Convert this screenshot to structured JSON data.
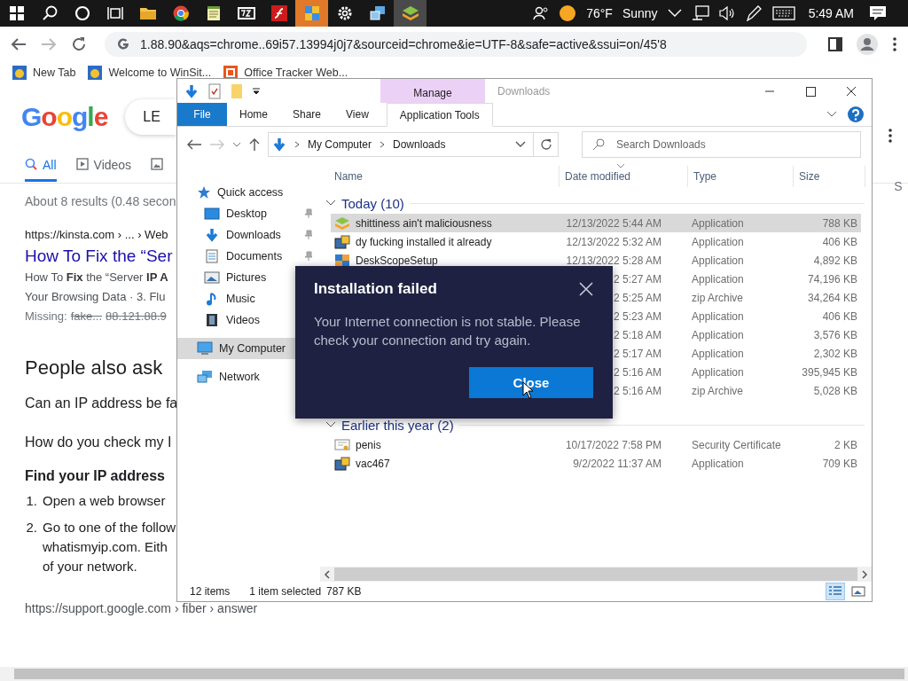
{
  "taskbar": {
    "apps": [
      {
        "kind": "windows",
        "selected": false
      },
      {
        "kind": "search",
        "selected": false
      },
      {
        "kind": "cortana",
        "selected": false
      },
      {
        "kind": "taskview",
        "selected": false
      },
      {
        "kind": "folder",
        "selected": false
      },
      {
        "kind": "chrome",
        "selected": false
      },
      {
        "kind": "notepad",
        "selected": false
      },
      {
        "kind": "sevenzip",
        "selected": false
      },
      {
        "kind": "flash",
        "selected": false
      },
      {
        "kind": "tiles",
        "selected": true
      },
      {
        "kind": "gear",
        "selected": false
      },
      {
        "kind": "network-app",
        "selected": false
      },
      {
        "kind": "stack",
        "selected": true
      }
    ],
    "tray": {
      "temperature": "76°F",
      "weather": "Sunny",
      "time": "5:49 AM"
    }
  },
  "browser": {
    "url": "1.88.90&aqs=chrome..69i57.13994j0j7&sourceid=chrome&ie=UTF-8&safe=active&ssui=on/45'8",
    "bookmarks": [
      {
        "label": "New Tab",
        "kind": "globe"
      },
      {
        "label": "Welcome to WinSit...",
        "kind": "globe"
      },
      {
        "label": "Office Tracker Web...",
        "kind": "office"
      }
    ]
  },
  "google": {
    "logo": "Google",
    "query": "LE",
    "edge_tab": "S",
    "tabs": [
      {
        "label": "All",
        "kind": "search",
        "selected": true
      },
      {
        "label": "Videos",
        "kind": "video",
        "selected": false
      },
      {
        "kind": "image",
        "selected": false
      }
    ],
    "stats": "About 8 results (0.48 secon",
    "result": {
      "url": "https://kinsta.com › ... › Web",
      "title": "How To Fix the “Ser",
      "snippet": [
        "How To **Fix** the “Server **IP A**",
        "Your Browsing Data · 3. Flu"
      ],
      "missing_label": "Missing:",
      "missing_terms": [
        "fake...",
        "88.121.88.9"
      ]
    },
    "people_also_ask": {
      "title": "People also ask",
      "questions": [
        "Can an IP address be fa",
        "How do you check my I"
      ]
    },
    "answer": {
      "heading": "Find your IP address",
      "steps": [
        {
          "number": "1.",
          "lines": [
            "Open a web browser"
          ]
        },
        {
          "number": "2.",
          "lines": [
            "Go to one of the follow",
            "whatismyip.com. Eith",
            "of your network."
          ]
        }
      ]
    },
    "source": "https://support.google.com › fiber › answer"
  },
  "explorer": {
    "title": "Downloads",
    "context_tab": "Manage",
    "ribbon_tabs": [
      {
        "label": "File",
        "kind": "file",
        "selected": false
      },
      {
        "label": "Home",
        "kind": "tab",
        "selected": false
      },
      {
        "label": "Share",
        "kind": "tab",
        "selected": false
      },
      {
        "label": "View",
        "kind": "tab",
        "selected": false
      },
      {
        "label": "Application Tools",
        "kind": "tab",
        "selected": true
      }
    ],
    "path": [
      "My Computer",
      "Downloads"
    ],
    "search_placeholder": "Search Downloads",
    "nav": [
      {
        "label": "Quick access",
        "kind": "star",
        "pinned": false,
        "selected": false,
        "children": [
          {
            "label": "Desktop",
            "kind": "desktop",
            "pinned": true,
            "selected": false
          },
          {
            "label": "Downloads",
            "kind": "download",
            "pinned": true,
            "selected": false
          },
          {
            "label": "Documents",
            "kind": "document",
            "pinned": true,
            "selected": false
          },
          {
            "label": "Pictures",
            "kind": "pictures",
            "selected": false
          },
          {
            "label": "Music",
            "kind": "music",
            "selected": false
          },
          {
            "label": "Videos",
            "kind": "film",
            "selected": false
          }
        ]
      },
      {
        "label": "My Computer",
        "kind": "computer",
        "selected": true
      },
      {
        "label": "Network",
        "kind": "network",
        "selected": false
      }
    ],
    "columns": [
      {
        "label": "Name",
        "sorted": false
      },
      {
        "label": "Date modified",
        "sorted": true
      },
      {
        "label": "Type",
        "sorted": false
      },
      {
        "label": "Size",
        "sorted": false
      }
    ],
    "groups": [
      {
        "label": "Today (10)",
        "expanded": true,
        "files": [
          {
            "name": "shittiness ain't maliciousness",
            "kind": "stack",
            "date": "12/13/2022 5:44 AM",
            "type": "Application",
            "size": "788 KB",
            "selected": true
          },
          {
            "name": "dy fucking installed it already",
            "kind": "installer",
            "date": "12/13/2022 5:32 AM",
            "type": "Application",
            "size": "406 KB",
            "selected": false
          },
          {
            "name": "DeskScopeSetup",
            "kind": "tiles",
            "date": "12/13/2022 5:28 AM",
            "type": "Application",
            "size": "4,892 KB",
            "selected": false
          },
          {
            "date": "2 5:27 AM",
            "type": "Application",
            "size": "74,196 KB",
            "selected": false
          },
          {
            "date": "2 5:25 AM",
            "type": "zip Archive",
            "size": "34,264 KB",
            "selected": false
          },
          {
            "date": "2 5:23 AM",
            "type": "Application",
            "size": "406 KB",
            "selected": false
          },
          {
            "date": "2 5:18 AM",
            "type": "Application",
            "size": "3,576 KB",
            "selected": false
          },
          {
            "date": "2 5:17 AM",
            "type": "Application",
            "size": "2,302 KB",
            "selected": false
          },
          {
            "date": "2 5:16 AM",
            "type": "Application",
            "size": "395,945 KB",
            "selected": false
          },
          {
            "date": "2 5:16 AM",
            "type": "zip Archive",
            "size": "5,028 KB",
            "selected": false
          }
        ]
      },
      {
        "label": "Earlier this year (2)",
        "expanded": true,
        "files": [
          {
            "name": "penis",
            "kind": "certificate",
            "date": "10/17/2022 7:58 PM",
            "type": "Security Certificate",
            "size": "2 KB",
            "selected": false
          },
          {
            "name": "vac467",
            "kind": "installer",
            "date": "9/2/2022 11:37 AM",
            "type": "Application",
            "size": "709 KB",
            "selected": false
          }
        ]
      }
    ],
    "status": {
      "count": "12 items",
      "selection": "1 item selected",
      "size": "787 KB"
    },
    "views": [
      {
        "kind": "details",
        "selected": true
      },
      {
        "kind": "thumbnails",
        "selected": false
      }
    ]
  },
  "dialog": {
    "title": "Installation failed",
    "message": "Your Internet connection is not stable. Please check your connection and try again.",
    "button": "Close"
  }
}
